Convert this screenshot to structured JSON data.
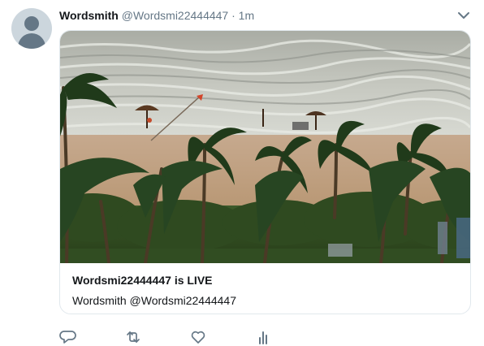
{
  "tweet": {
    "display_name": "Wordsmith",
    "handle": "@Wordsmi22444447",
    "separator": "·",
    "time": "1m",
    "avatar_icon": "default-avatar-icon",
    "menu_icon": "chevron-down-icon"
  },
  "card": {
    "image_icon": "storm-beach-palms-image",
    "title": "Wordsmi22444447 is LIVE",
    "subtitle": "Wordsmith @Wordsmi22444447"
  },
  "actions": [
    "reply-icon",
    "retweet-icon",
    "like-icon",
    "analytics-icon"
  ],
  "colors": {
    "text": "#14171a",
    "muted": "#657786",
    "border": "#e1e8ed",
    "avatar_bg": "#ccd6dd"
  }
}
